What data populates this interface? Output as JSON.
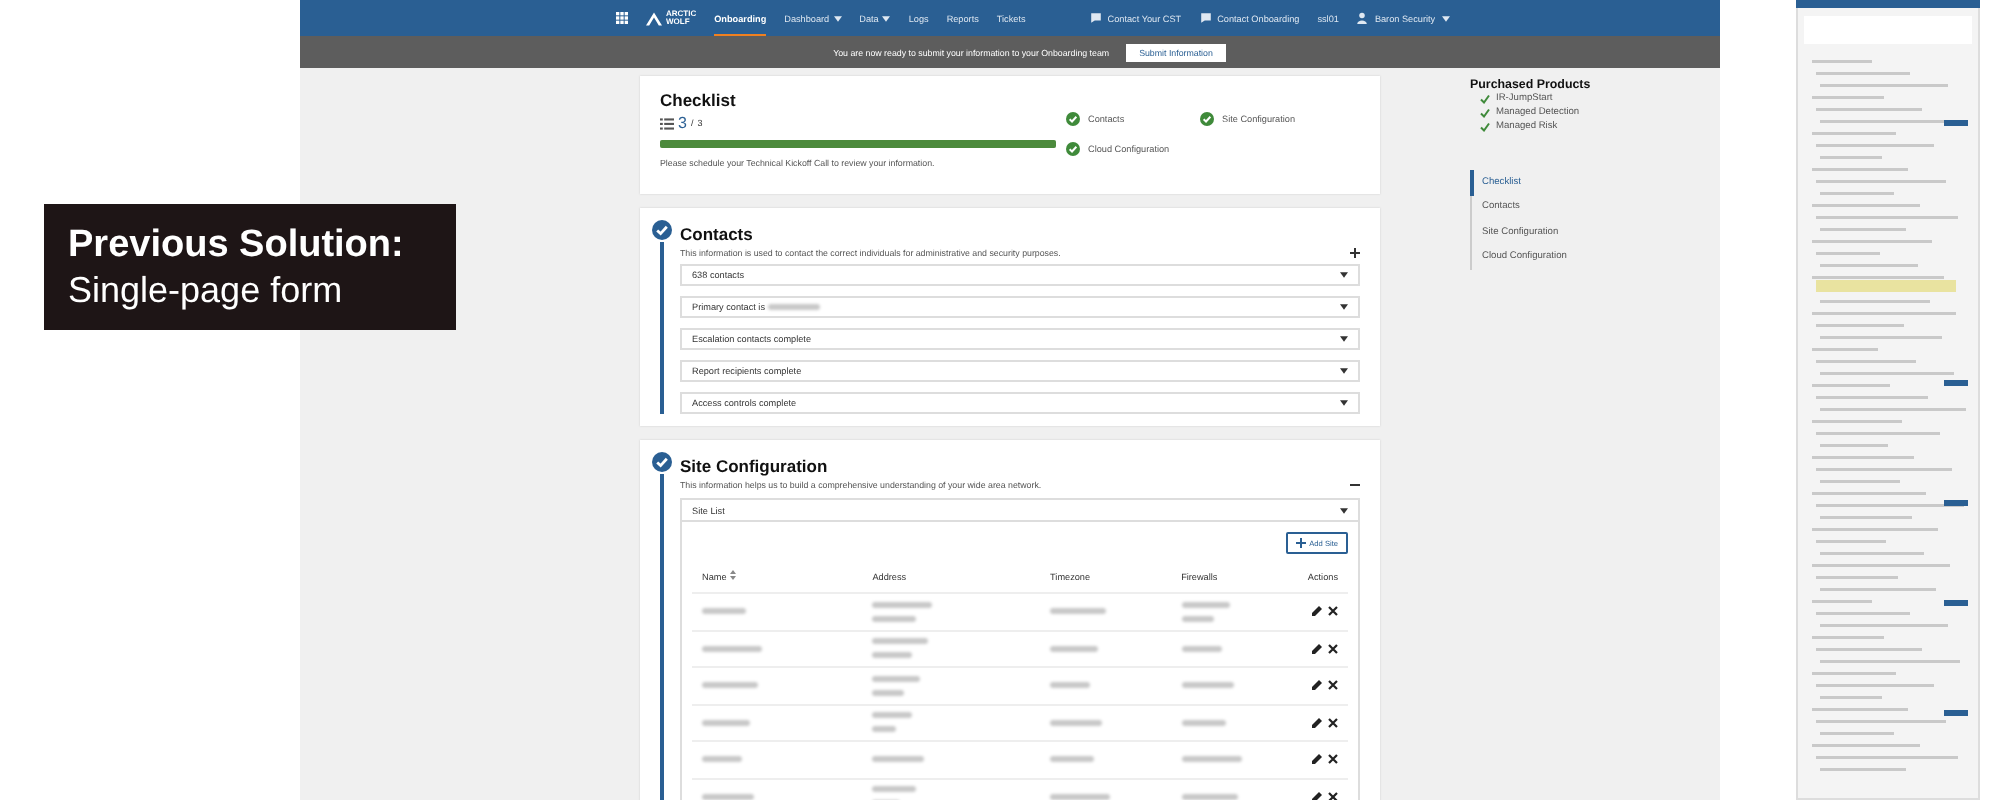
{
  "caption": {
    "title": "Previous Solution:",
    "subtitle": "Single-page form"
  },
  "nav": {
    "logo_top": "ARCTIC",
    "logo_bottom": "WOLF",
    "items": [
      {
        "label": "Onboarding",
        "selected": true,
        "dropdown": false
      },
      {
        "label": "Dashboard",
        "selected": false,
        "dropdown": true
      },
      {
        "label": "Data",
        "selected": false,
        "dropdown": true
      },
      {
        "label": "Logs",
        "selected": false,
        "dropdown": false
      },
      {
        "label": "Reports",
        "selected": false,
        "dropdown": false
      },
      {
        "label": "Tickets",
        "selected": false,
        "dropdown": false
      }
    ],
    "right_items": [
      {
        "label": "Contact Your CST",
        "kind": "chat",
        "dropdown": false
      },
      {
        "label": "Contact Onboarding",
        "kind": "chat",
        "dropdown": false
      },
      {
        "label": "ssl01",
        "kind": "plain",
        "dropdown": false
      },
      {
        "label": "Baron Security",
        "kind": "user",
        "dropdown": true
      }
    ]
  },
  "banner": {
    "message": "You are now ready to submit your information to your Onboarding team",
    "button": "Submit Information"
  },
  "checklist": {
    "title": "Checklist",
    "done": "3",
    "separator": "/",
    "total": "3",
    "level": 1,
    "note": "Please schedule your Technical Kickoff Call to review your information.",
    "items": [
      {
        "label": "Contacts",
        "done": true
      },
      {
        "label": "Site Configuration",
        "done": true
      },
      {
        "label": "Cloud Configuration",
        "done": true
      }
    ]
  },
  "sections": [
    {
      "title": "Contacts",
      "description": "This information is used to contact the correct individuals for administrative and security purposes.",
      "complete": true,
      "expanded": false,
      "rows": [
        {
          "label": "638 contacts",
          "redacted": false
        },
        {
          "label": "Primary contact is",
          "redacted": true
        },
        {
          "label": "Escalation contacts complete",
          "redacted": false
        },
        {
          "label": "Report recipients complete",
          "redacted": false
        },
        {
          "label": "Access controls complete",
          "redacted": false
        }
      ]
    },
    {
      "title": "Site Configuration",
      "description": "This information helps us to build a comprehensive understanding of your wide area network.",
      "complete": true,
      "expanded": true,
      "panel": {
        "title": "Site List",
        "add_button": "Add Site",
        "columns": [
          {
            "label": "Name",
            "sortable": true
          },
          {
            "label": "Address",
            "sortable": false
          },
          {
            "label": "Timezone",
            "sortable": false
          },
          {
            "label": "Firewalls",
            "sortable": false
          },
          {
            "label": "Actions",
            "sortable": false
          }
        ],
        "rows": [
          {
            "redacted": true
          },
          {
            "redacted": true
          },
          {
            "redacted": true
          },
          {
            "redacted": true
          },
          {
            "redacted": true
          },
          {
            "redacted": true
          }
        ]
      }
    }
  ],
  "sidebar": {
    "products_title": "Purchased Products",
    "products": [
      {
        "label": "IR-JumpStart",
        "checked": true
      },
      {
        "label": "Managed Detection",
        "checked": true
      },
      {
        "label": "Managed Risk",
        "checked": true
      }
    ],
    "links": [
      {
        "label": "Checklist",
        "selected": true
      },
      {
        "label": "Contacts",
        "selected": false
      },
      {
        "label": "Site Configuration",
        "selected": false
      },
      {
        "label": "Cloud Configuration",
        "selected": false
      }
    ]
  }
}
